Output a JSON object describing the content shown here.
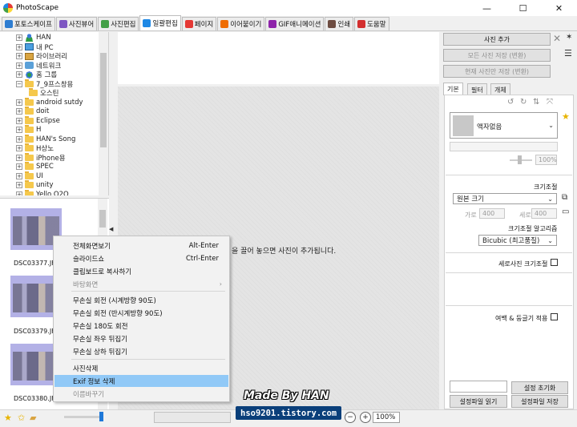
{
  "window": {
    "title": "PhotoScape",
    "minimize": "—",
    "maximize": "☐",
    "close": "✕"
  },
  "tabs": [
    {
      "label": "포토스케이프",
      "color": "#2e7dd1"
    },
    {
      "label": "사진뷰어",
      "color": "#7e57c2"
    },
    {
      "label": "사진편집",
      "color": "#43a047"
    },
    {
      "label": "일괄편집",
      "color": "#1e88e5"
    },
    {
      "label": "페이지",
      "color": "#e53935"
    },
    {
      "label": "이어붙이기",
      "color": "#ef6c00"
    },
    {
      "label": "GIF애니메이션",
      "color": "#8e24aa"
    },
    {
      "label": "인쇄",
      "color": "#6d4c41"
    },
    {
      "label": "도움말",
      "color": "#d32f2f"
    }
  ],
  "active_tab": "일괄편집",
  "tree": {
    "items": [
      {
        "label": "HAN",
        "icon": "user-icon"
      },
      {
        "label": "내 PC",
        "icon": "pc-icon"
      },
      {
        "label": "라이브러리",
        "icon": "library-icon"
      },
      {
        "label": "네트워크",
        "icon": "network-icon"
      },
      {
        "label": "홈 그룹",
        "icon": "homegroup-icon"
      },
      {
        "label": "7_9프스창용",
        "icon": "folder-icon"
      },
      {
        "label": "오스틴",
        "icon": "folder-icon"
      },
      {
        "label": "android sutdy",
        "icon": "folder-icon"
      },
      {
        "label": "doit",
        "icon": "folder-icon"
      },
      {
        "label": "Eclipse",
        "icon": "folder-icon"
      },
      {
        "label": "H",
        "icon": "folder-icon"
      },
      {
        "label": "HAN's Song",
        "icon": "folder-icon"
      },
      {
        "label": "H상노",
        "icon": "folder-icon"
      },
      {
        "label": "iPhone용",
        "icon": "folder-icon"
      },
      {
        "label": "SPEC",
        "icon": "folder-icon"
      },
      {
        "label": "UI",
        "icon": "folder-icon"
      },
      {
        "label": "unity",
        "icon": "folder-icon"
      },
      {
        "label": "Yello O2O",
        "icon": "folder-icon"
      }
    ]
  },
  "thumbnails": [
    {
      "label": "DSC03377.JF"
    },
    {
      "label": "DSC03379.JF"
    },
    {
      "label": "DSC03380.JF"
    }
  ],
  "center": {
    "drop_message": "을 끌어 놓으면 사진이 추가됩니다."
  },
  "context_menu": {
    "items": [
      {
        "label": "전체화면보기",
        "shortcut": "Alt-Enter",
        "disabled": false
      },
      {
        "label": "슬라이드쇼",
        "shortcut": "Ctrl-Enter",
        "disabled": false
      },
      {
        "label": "클립보드로 복사하기",
        "shortcut": "",
        "disabled": false
      },
      {
        "label": "바탕화면",
        "shortcut": "",
        "disabled": true,
        "submenu": "›"
      },
      {
        "label": "무손실 회전 (시계방향 90도)",
        "shortcut": "",
        "disabled": false
      },
      {
        "label": "무손실 회전 (반시계방향 90도)",
        "shortcut": "",
        "disabled": false
      },
      {
        "label": "무손실 180도 회전",
        "shortcut": "",
        "disabled": false
      },
      {
        "label": "무손실 좌우 뒤집기",
        "shortcut": "",
        "disabled": false
      },
      {
        "label": "무손실 상하 뒤집기",
        "shortcut": "",
        "disabled": false
      },
      {
        "label": "사진삭제",
        "shortcut": "",
        "disabled": false
      },
      {
        "label": "Exif 정보 삭제",
        "shortcut": "",
        "disabled": false,
        "highlighted": true
      },
      {
        "label": "이름바꾸기",
        "shortcut": "",
        "disabled": true
      }
    ]
  },
  "right_panel": {
    "add_photo": "사진 추가",
    "save_all": "모든 사진 저장 (변환)",
    "save_current": "현재 사진만 저장 (변환)",
    "tabs": [
      "기본",
      "필터",
      "개체"
    ],
    "frame_label": "액자없음",
    "frame_percent": "100%",
    "resize_title": "크기조절",
    "resize_option": "원본 크기",
    "width_label": "가로",
    "width_value": "400",
    "height_label": "세로",
    "height_value": "400",
    "algo_title": "크기조절 알고리즘",
    "algo_option": "Bicubic (최고품질)",
    "portrait_resize": "세로사진 크기조절",
    "margin_round": "여백 & 둥글기 적용",
    "reset_settings": "설정 초기화",
    "load_settings": "설정파일 읽기",
    "save_settings": "설정파일 저장"
  },
  "status": {
    "zoom": "100%",
    "zoom_in": "+",
    "zoom_out": "−",
    "percent_hint": "% ▾"
  },
  "watermark": {
    "line1": "Made By HAN",
    "line2": "hso9201.tistory.com"
  },
  "colors": {
    "thumb_bg": "#b3b1e6",
    "highlight": "#91c9f7",
    "watermark_bg": "#0a3f7a"
  }
}
